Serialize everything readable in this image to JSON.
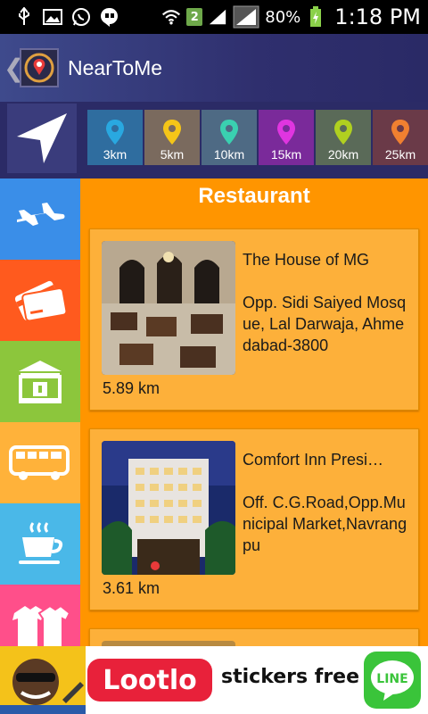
{
  "status_bar": {
    "notification_badge": "2",
    "battery": "80%",
    "time": "1:18 PM"
  },
  "action_bar": {
    "back_glyph": "❮",
    "title": "NearToMe"
  },
  "ranges": [
    {
      "label": "3km",
      "bg": "#2f6d9f",
      "pin": "#29a8e0"
    },
    {
      "label": "5km",
      "bg": "#7a6a5e",
      "pin": "#f5c518"
    },
    {
      "label": "10km",
      "bg": "#4e6a84",
      "pin": "#3ad0b0"
    },
    {
      "label": "15km",
      "bg": "#7a2a9a",
      "pin": "#e035e0"
    },
    {
      "label": "20km",
      "bg": "#5a6a58",
      "pin": "#b0d020"
    },
    {
      "label": "25km",
      "bg": "#6a3a48",
      "pin": "#f08030"
    }
  ],
  "sidebar": [
    {
      "name": "airport-icon",
      "bg": "#3a8ee8"
    },
    {
      "name": "atm-card-icon",
      "bg": "#ff5a1e"
    },
    {
      "name": "bank-icon",
      "bg": "#8cc63c"
    },
    {
      "name": "bus-icon",
      "bg": "#ffb23a"
    },
    {
      "name": "cafe-icon",
      "bg": "#4ab8e8"
    },
    {
      "name": "clothing-icon",
      "bg": "#ff4f8a"
    }
  ],
  "main": {
    "section_title": "Restaurant",
    "cards": [
      {
        "name": "The House of MG",
        "address": "Opp. Sidi Saiyed Mosque, Lal Darwaja, Ahmedabad-3800",
        "distance": "5.89 km"
      },
      {
        "name": "Comfort Inn Presi…",
        "address": "Off. C.G.Road,Opp.Municipal Market,Navrangpu",
        "distance": "3.61 km"
      }
    ]
  },
  "ad": {
    "brand": "Lootlo",
    "tagline": "stickers free",
    "line_label": "LINE"
  }
}
